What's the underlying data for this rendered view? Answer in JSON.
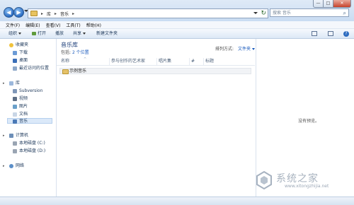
{
  "address": {
    "crumbs": [
      "库",
      "音乐"
    ],
    "search_placeholder": "搜索 音乐"
  },
  "window_controls": {
    "minimize": "—",
    "maximize": "□",
    "close": "✕"
  },
  "menu": [
    "文件(F)",
    "编辑(E)",
    "查看(V)",
    "工具(T)",
    "帮助(H)"
  ],
  "commands": {
    "organize": "组织",
    "open": "打开",
    "play_all": "播放",
    "share": "共享",
    "new_folder": "新建文件夹"
  },
  "nav": {
    "favorites": "收藏夹",
    "downloads": "下载",
    "desktop": "桌面",
    "recent": "最近访问的位置",
    "libraries": "库",
    "subversion": "Subversion",
    "videos": "视频",
    "pictures": "图片",
    "documents": "文档",
    "music": "音乐",
    "computer": "计算机",
    "drive_c": "本地磁盘 (C:)",
    "drive_d": "本地磁盘 (D:)",
    "network": "网络"
  },
  "library": {
    "title": "音乐库",
    "subtitle_prefix": "包括:",
    "subtitle_link": "2 个位置",
    "arrange_label": "排列方式:",
    "arrange_value": "文件夹"
  },
  "columns": [
    "名称",
    "参与创作的艺术家",
    "唱片集",
    "#",
    "标题"
  ],
  "rows": [
    {
      "name": "示例音乐"
    }
  ],
  "preview": {
    "message": "没有预览。"
  },
  "watermark": {
    "text": "系统之家",
    "url": "www.xitongzhijia.net"
  },
  "colors": {
    "accent": "#1b5bbd",
    "title_bar": "#c9dcf2",
    "close_button": "#c7432b"
  }
}
